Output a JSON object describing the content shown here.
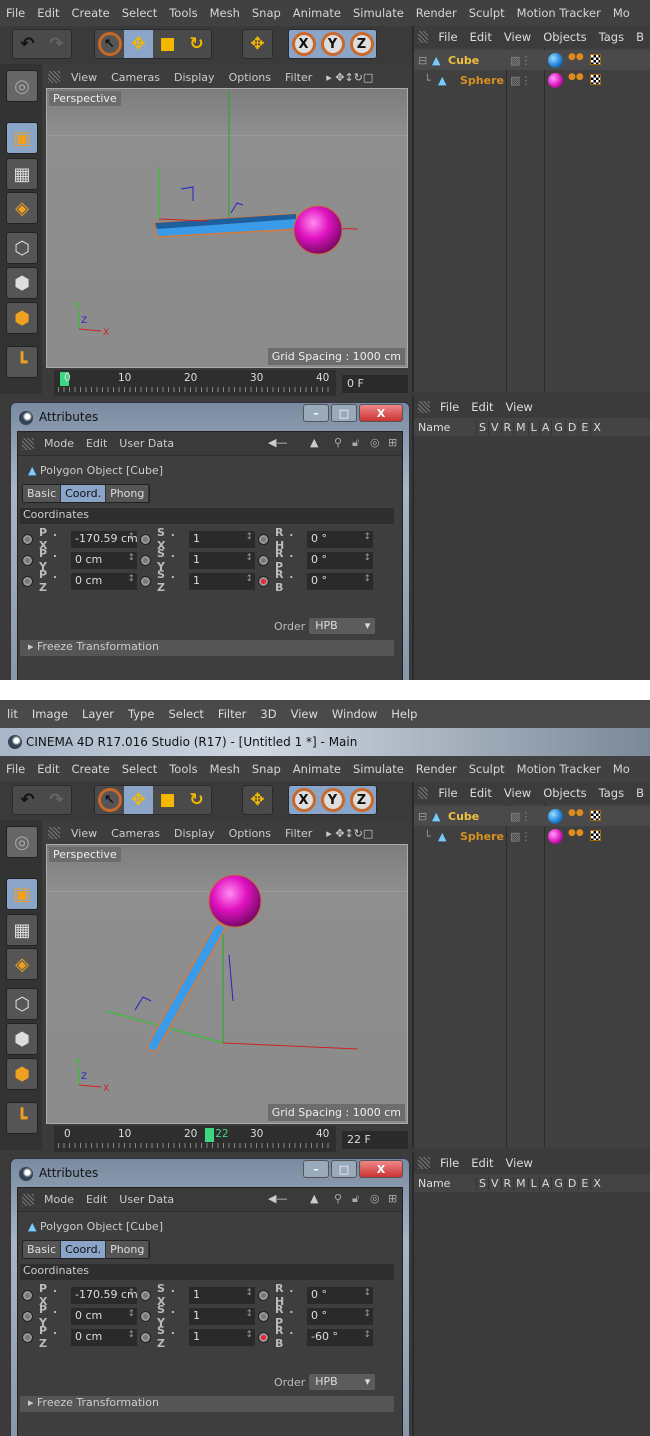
{
  "app": {
    "menu": [
      "File",
      "Edit",
      "Create",
      "Select",
      "Tools",
      "Mesh",
      "Snap",
      "Animate",
      "Simulate",
      "Render",
      "Sculpt",
      "Motion Tracker",
      "Mo"
    ],
    "viewport_menu": [
      "View",
      "Cameras",
      "Display",
      "Options",
      "Filter"
    ],
    "viewport_label": "Perspective",
    "grid_spacing": "Grid Spacing : 1000 cm",
    "timeline_ticks": [
      "0",
      "10",
      "20",
      "30",
      "40"
    ],
    "object_manager_menu": [
      "File",
      "Edit",
      "View",
      "Objects",
      "Tags",
      "B"
    ],
    "objects": [
      {
        "name": "Cube",
        "color": "#f0c040",
        "tag": "#2a8ae0"
      },
      {
        "name": "Sphere",
        "color": "#d89020",
        "tag": "#e020c0"
      }
    ],
    "layer_menu": [
      "File",
      "Edit",
      "View"
    ],
    "layer_columns": [
      "Name",
      "S",
      "V",
      "R",
      "M",
      "L",
      "A",
      "G",
      "D",
      "E",
      "X"
    ],
    "attributes": {
      "title": "Attributes",
      "menu": [
        "Mode",
        "Edit",
        "User Data"
      ],
      "object_title": "Polygon Object [Cube]",
      "tabs": [
        "Basic",
        "Coord.",
        "Phong"
      ],
      "active_tab": "Coord.",
      "section": "Coordinates",
      "labels": {
        "px": "P . X",
        "py": "P . Y",
        "pz": "P . Z",
        "sx": "S . X",
        "sy": "S . Y",
        "sz": "S . Z",
        "rh": "R . H",
        "rp": "R . P",
        "rb": "R . B"
      },
      "order_label": "Order",
      "order_value": "HPB",
      "freeze": "Freeze Transformation",
      "close": "X"
    },
    "accent": "#8aa5c8"
  },
  "photoshop_menu": [
    "lit",
    "Image",
    "Layer",
    "Type",
    "Select",
    "Filter",
    "3D",
    "View",
    "Window",
    "Help"
  ],
  "window_title": "CINEMA 4D R17.016 Studio (R17) - [Untitled 1 *] - Main",
  "screens": [
    {
      "frame": "0 F",
      "current_frame": "0",
      "fields": {
        "px": "-170.59 cm",
        "py": "0 cm",
        "pz": "0 cm",
        "sx": "1",
        "sy": "1",
        "sz": "1",
        "rh": "0 °",
        "rp": "0 °",
        "rb": "0 °"
      }
    },
    {
      "frame": "22 F",
      "current_frame": "22",
      "fields": {
        "px": "-170.59 cm",
        "py": "0 cm",
        "pz": "0 cm",
        "sx": "1",
        "sy": "1",
        "sz": "1",
        "rh": "0 °",
        "rp": "0 °",
        "rb": "-60 °"
      }
    }
  ]
}
